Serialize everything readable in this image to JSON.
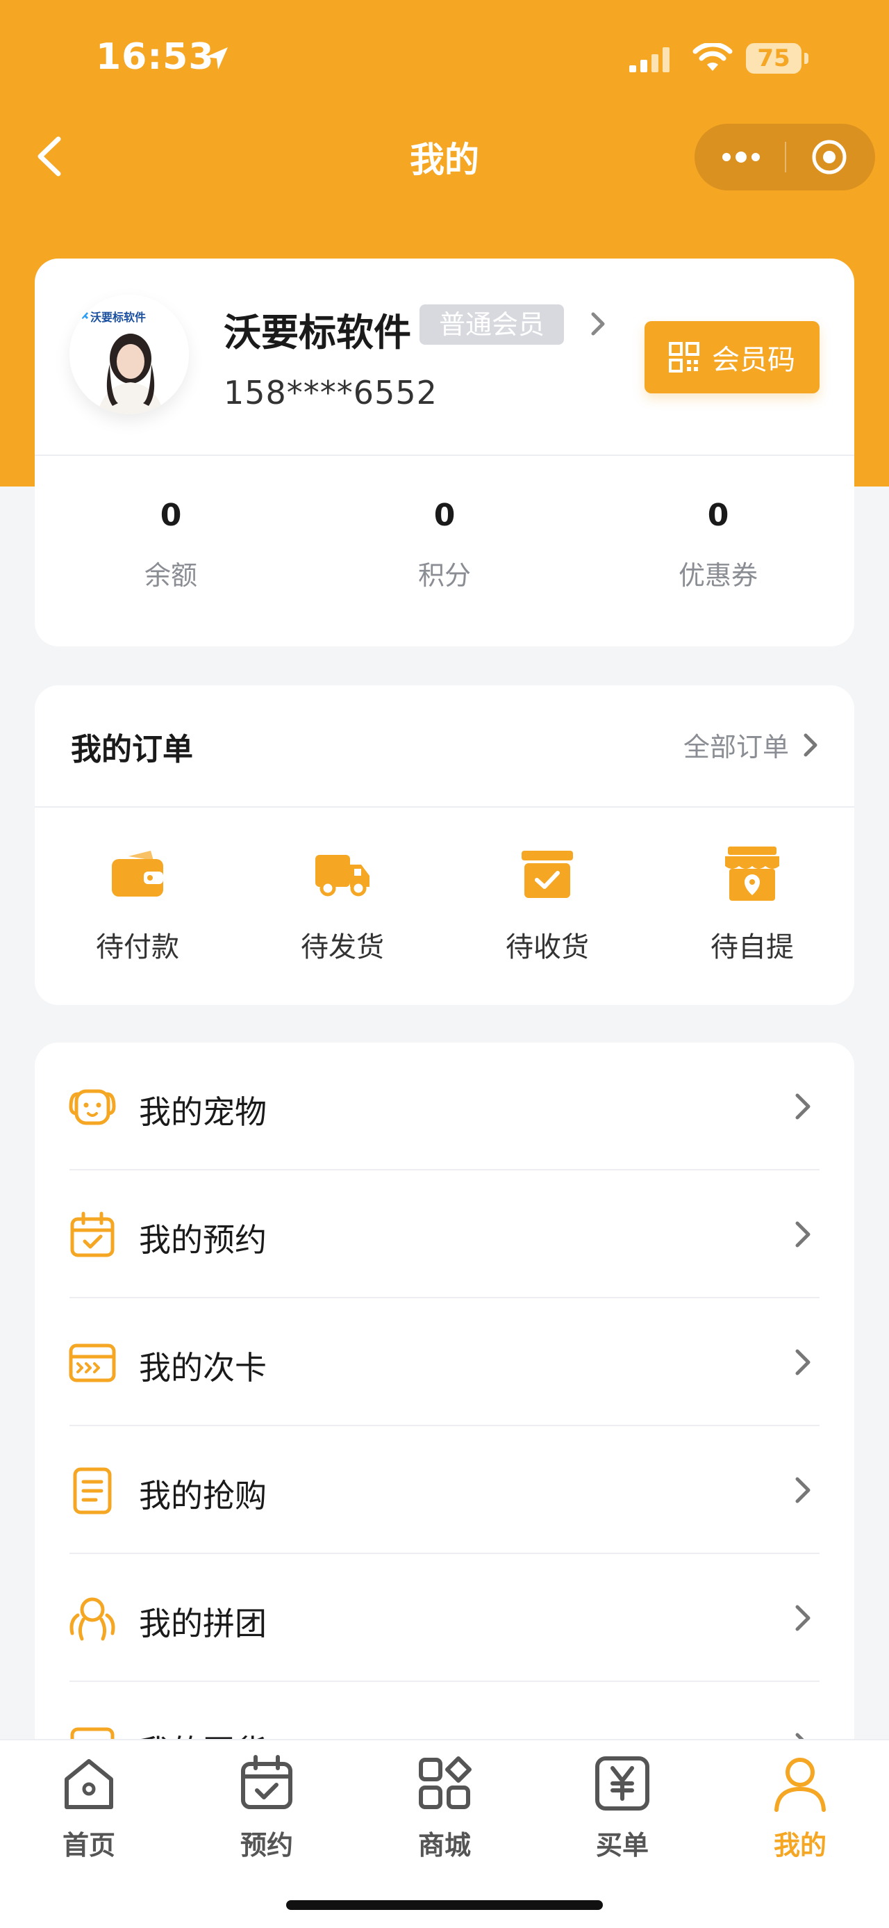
{
  "status_bar": {
    "time": "16:53",
    "battery": "75"
  },
  "nav": {
    "title": "我的"
  },
  "profile": {
    "logo_text": "沃要标软件",
    "name": "沃要标软件",
    "member_level": "普通会员",
    "phone": "158****6552",
    "member_code_label": "会员码",
    "stats": [
      {
        "value": "0",
        "label": "余额"
      },
      {
        "value": "0",
        "label": "积分"
      },
      {
        "value": "0",
        "label": "优惠券"
      }
    ]
  },
  "orders": {
    "title": "我的订单",
    "all_label": "全部订单",
    "items": [
      {
        "label": "待付款",
        "icon": "wallet-icon"
      },
      {
        "label": "待发货",
        "icon": "truck-icon"
      },
      {
        "label": "待收货",
        "icon": "box-check-icon"
      },
      {
        "label": "待自提",
        "icon": "store-pin-icon"
      }
    ]
  },
  "menu": {
    "items": [
      {
        "label": "我的宠物",
        "icon": "pet-icon"
      },
      {
        "label": "我的预约",
        "icon": "calendar-check-icon"
      },
      {
        "label": "我的次卡",
        "icon": "card-icon"
      },
      {
        "label": "我的抢购",
        "icon": "document-icon"
      },
      {
        "label": "我的拼团",
        "icon": "group-icon"
      },
      {
        "label": "我的团货",
        "icon": "bag-icon"
      }
    ]
  },
  "tabbar": {
    "items": [
      {
        "label": "首页",
        "icon": "home-icon"
      },
      {
        "label": "预约",
        "icon": "calendar-check-icon"
      },
      {
        "label": "商城",
        "icon": "grid-icon"
      },
      {
        "label": "买单",
        "icon": "yen-icon"
      },
      {
        "label": "我的",
        "icon": "user-icon"
      }
    ],
    "active_index": 4
  },
  "colors": {
    "accent": "#f5a623",
    "background": "#f4f5f7"
  }
}
